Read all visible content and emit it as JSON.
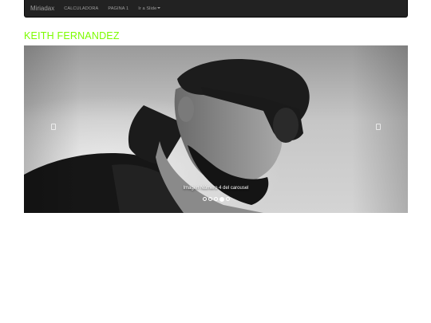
{
  "navbar": {
    "brand": "Miriadax",
    "links": [
      "CALCULADORA",
      "PAGINA 1"
    ],
    "dropdown_label": "Ir a Slide"
  },
  "page": {
    "title": "KEITH FERNANDEZ",
    "title_color": "#7cfc00"
  },
  "carousel": {
    "caption": "Imagen Número 4 del carousel",
    "slide_count": 5,
    "active_index": 3
  }
}
